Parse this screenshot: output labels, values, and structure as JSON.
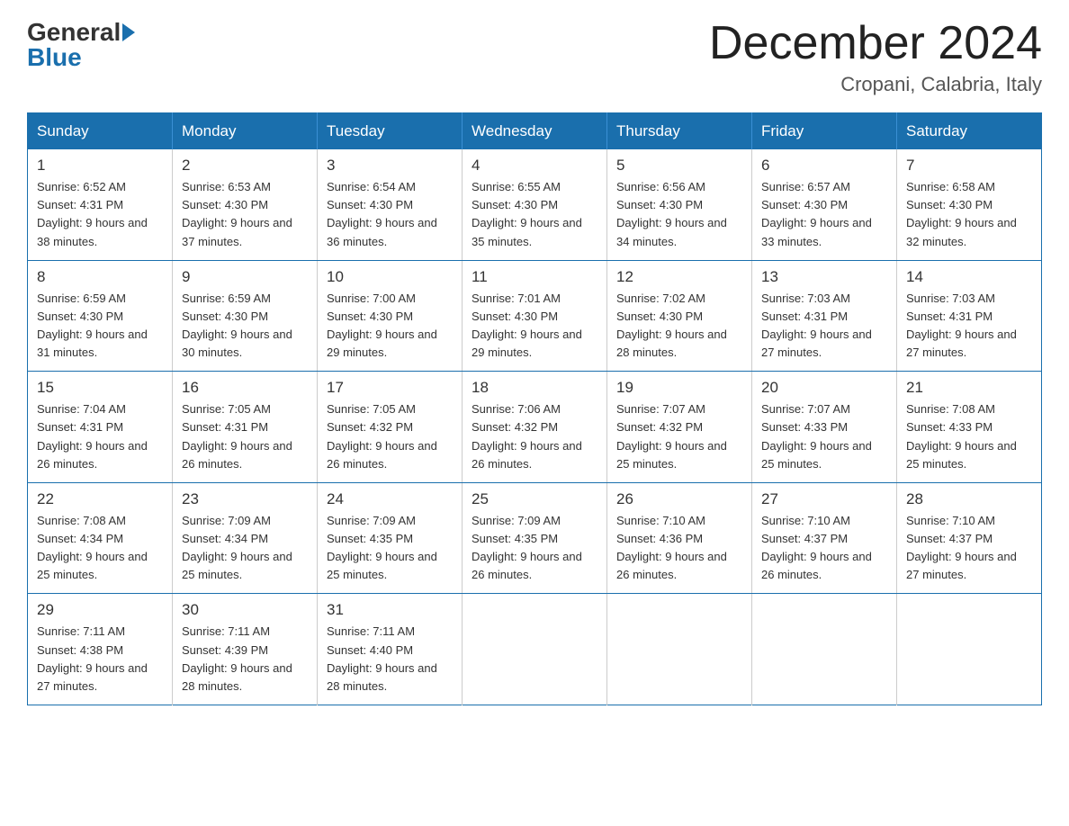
{
  "header": {
    "logo_general": "General",
    "logo_blue": "Blue",
    "month_title": "December 2024",
    "location": "Cropani, Calabria, Italy"
  },
  "days_of_week": [
    "Sunday",
    "Monday",
    "Tuesday",
    "Wednesday",
    "Thursday",
    "Friday",
    "Saturday"
  ],
  "weeks": [
    [
      {
        "day": "1",
        "sunrise": "6:52 AM",
        "sunset": "4:31 PM",
        "daylight": "9 hours and 38 minutes."
      },
      {
        "day": "2",
        "sunrise": "6:53 AM",
        "sunset": "4:30 PM",
        "daylight": "9 hours and 37 minutes."
      },
      {
        "day": "3",
        "sunrise": "6:54 AM",
        "sunset": "4:30 PM",
        "daylight": "9 hours and 36 minutes."
      },
      {
        "day": "4",
        "sunrise": "6:55 AM",
        "sunset": "4:30 PM",
        "daylight": "9 hours and 35 minutes."
      },
      {
        "day": "5",
        "sunrise": "6:56 AM",
        "sunset": "4:30 PM",
        "daylight": "9 hours and 34 minutes."
      },
      {
        "day": "6",
        "sunrise": "6:57 AM",
        "sunset": "4:30 PM",
        "daylight": "9 hours and 33 minutes."
      },
      {
        "day": "7",
        "sunrise": "6:58 AM",
        "sunset": "4:30 PM",
        "daylight": "9 hours and 32 minutes."
      }
    ],
    [
      {
        "day": "8",
        "sunrise": "6:59 AM",
        "sunset": "4:30 PM",
        "daylight": "9 hours and 31 minutes."
      },
      {
        "day": "9",
        "sunrise": "6:59 AM",
        "sunset": "4:30 PM",
        "daylight": "9 hours and 30 minutes."
      },
      {
        "day": "10",
        "sunrise": "7:00 AM",
        "sunset": "4:30 PM",
        "daylight": "9 hours and 29 minutes."
      },
      {
        "day": "11",
        "sunrise": "7:01 AM",
        "sunset": "4:30 PM",
        "daylight": "9 hours and 29 minutes."
      },
      {
        "day": "12",
        "sunrise": "7:02 AM",
        "sunset": "4:30 PM",
        "daylight": "9 hours and 28 minutes."
      },
      {
        "day": "13",
        "sunrise": "7:03 AM",
        "sunset": "4:31 PM",
        "daylight": "9 hours and 27 minutes."
      },
      {
        "day": "14",
        "sunrise": "7:03 AM",
        "sunset": "4:31 PM",
        "daylight": "9 hours and 27 minutes."
      }
    ],
    [
      {
        "day": "15",
        "sunrise": "7:04 AM",
        "sunset": "4:31 PM",
        "daylight": "9 hours and 26 minutes."
      },
      {
        "day": "16",
        "sunrise": "7:05 AM",
        "sunset": "4:31 PM",
        "daylight": "9 hours and 26 minutes."
      },
      {
        "day": "17",
        "sunrise": "7:05 AM",
        "sunset": "4:32 PM",
        "daylight": "9 hours and 26 minutes."
      },
      {
        "day": "18",
        "sunrise": "7:06 AM",
        "sunset": "4:32 PM",
        "daylight": "9 hours and 26 minutes."
      },
      {
        "day": "19",
        "sunrise": "7:07 AM",
        "sunset": "4:32 PM",
        "daylight": "9 hours and 25 minutes."
      },
      {
        "day": "20",
        "sunrise": "7:07 AM",
        "sunset": "4:33 PM",
        "daylight": "9 hours and 25 minutes."
      },
      {
        "day": "21",
        "sunrise": "7:08 AM",
        "sunset": "4:33 PM",
        "daylight": "9 hours and 25 minutes."
      }
    ],
    [
      {
        "day": "22",
        "sunrise": "7:08 AM",
        "sunset": "4:34 PM",
        "daylight": "9 hours and 25 minutes."
      },
      {
        "day": "23",
        "sunrise": "7:09 AM",
        "sunset": "4:34 PM",
        "daylight": "9 hours and 25 minutes."
      },
      {
        "day": "24",
        "sunrise": "7:09 AM",
        "sunset": "4:35 PM",
        "daylight": "9 hours and 25 minutes."
      },
      {
        "day": "25",
        "sunrise": "7:09 AM",
        "sunset": "4:35 PM",
        "daylight": "9 hours and 26 minutes."
      },
      {
        "day": "26",
        "sunrise": "7:10 AM",
        "sunset": "4:36 PM",
        "daylight": "9 hours and 26 minutes."
      },
      {
        "day": "27",
        "sunrise": "7:10 AM",
        "sunset": "4:37 PM",
        "daylight": "9 hours and 26 minutes."
      },
      {
        "day": "28",
        "sunrise": "7:10 AM",
        "sunset": "4:37 PM",
        "daylight": "9 hours and 27 minutes."
      }
    ],
    [
      {
        "day": "29",
        "sunrise": "7:11 AM",
        "sunset": "4:38 PM",
        "daylight": "9 hours and 27 minutes."
      },
      {
        "day": "30",
        "sunrise": "7:11 AM",
        "sunset": "4:39 PM",
        "daylight": "9 hours and 28 minutes."
      },
      {
        "day": "31",
        "sunrise": "7:11 AM",
        "sunset": "4:40 PM",
        "daylight": "9 hours and 28 minutes."
      },
      null,
      null,
      null,
      null
    ]
  ]
}
